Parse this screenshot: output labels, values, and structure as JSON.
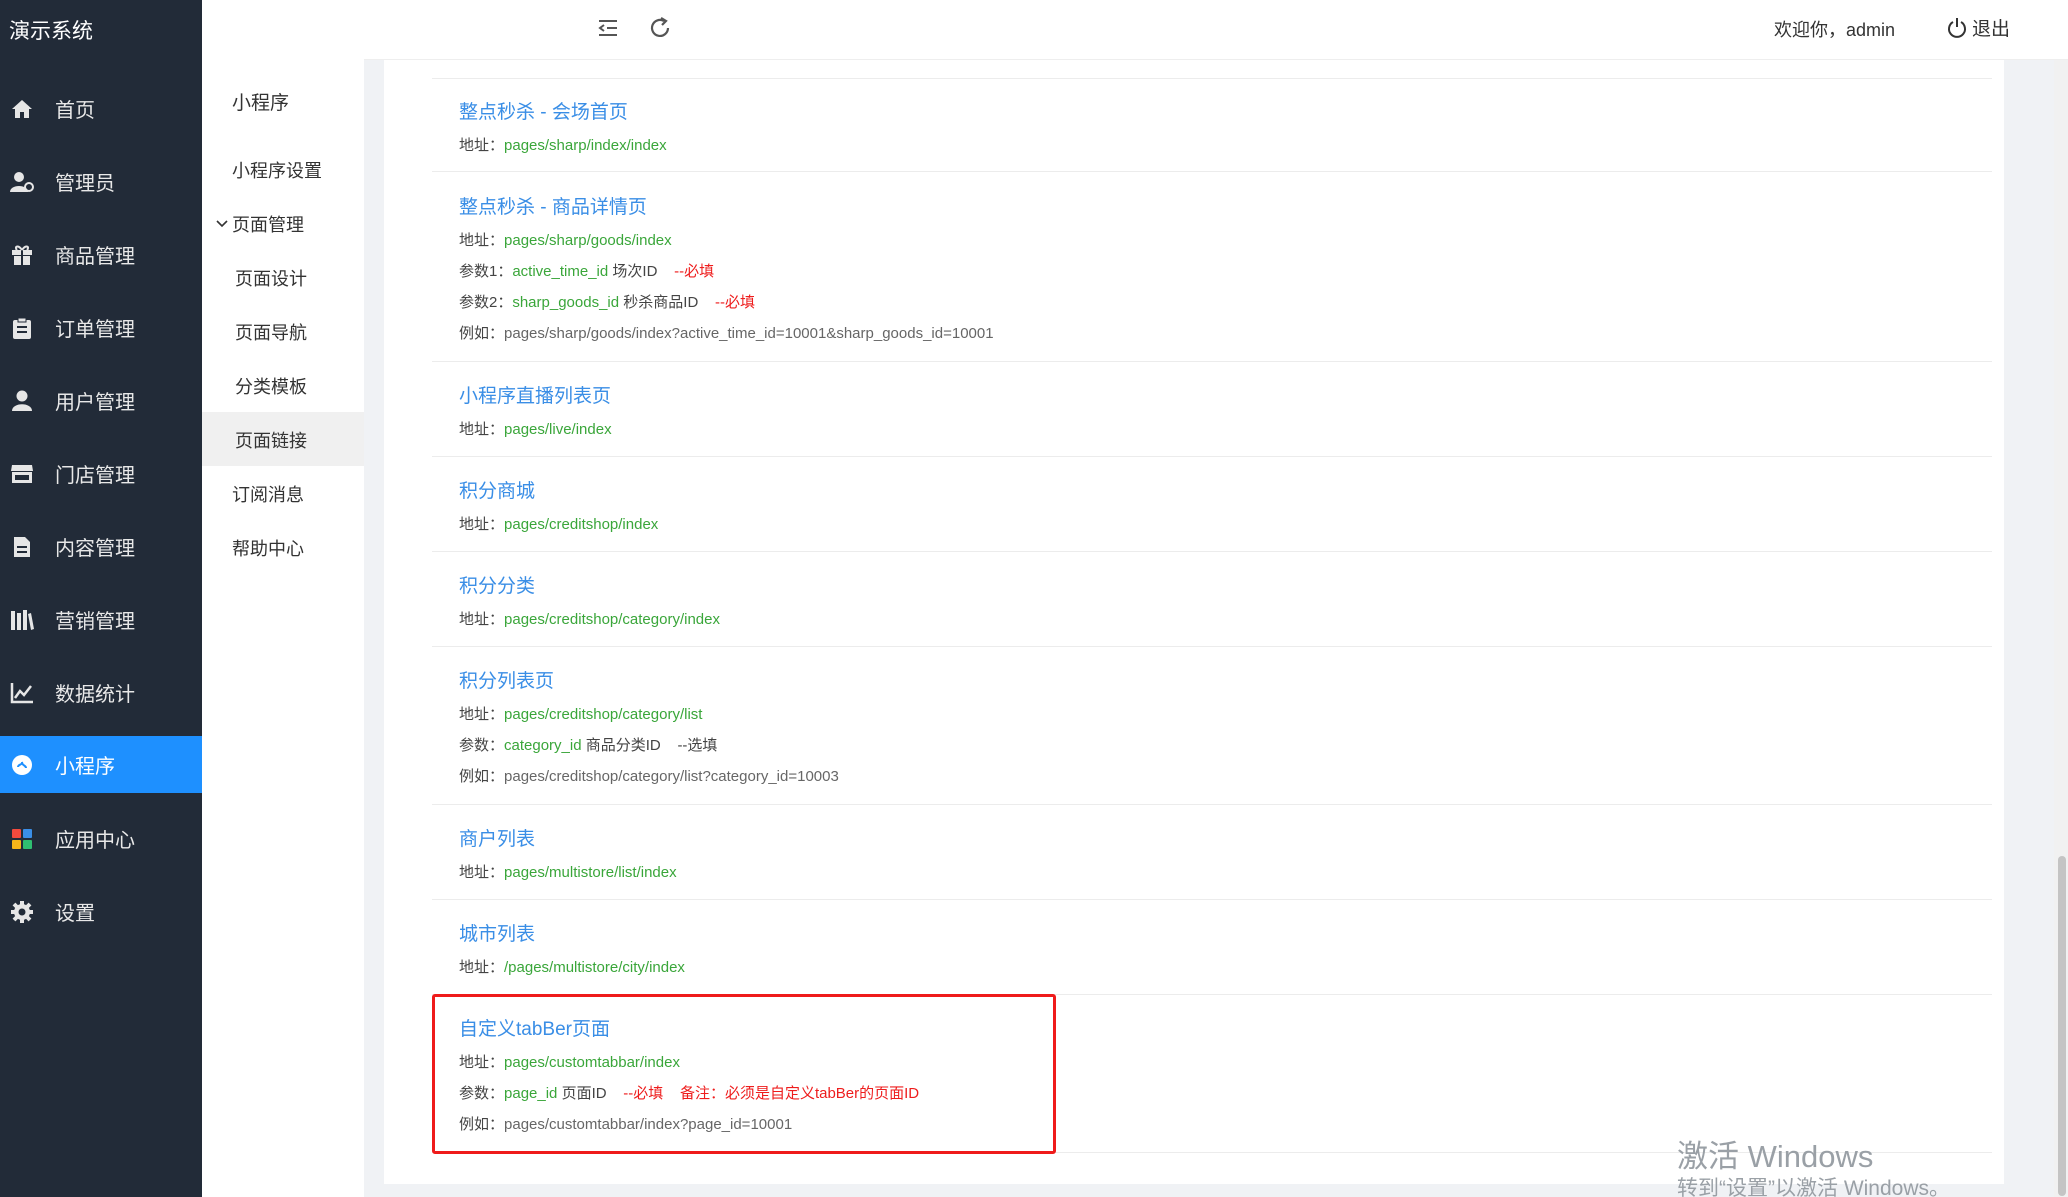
{
  "app": {
    "title": "演示系统"
  },
  "sidebar": {
    "items": [
      {
        "label": "首页",
        "icon": "home-icon"
      },
      {
        "label": "管理员",
        "icon": "admin-user-icon"
      },
      {
        "label": "商品管理",
        "icon": "gift-icon"
      },
      {
        "label": "订单管理",
        "icon": "clipboard-icon"
      },
      {
        "label": "用户管理",
        "icon": "user-icon"
      },
      {
        "label": "门店管理",
        "icon": "store-icon"
      },
      {
        "label": "内容管理",
        "icon": "document-icon"
      },
      {
        "label": "营销管理",
        "icon": "books-icon"
      },
      {
        "label": "数据统计",
        "icon": "line-chart-icon"
      },
      {
        "label": "小程序",
        "icon": "mini-program-icon",
        "active": true
      },
      {
        "label": "应用中心",
        "icon": "apps-grid-icon"
      },
      {
        "label": "设置",
        "icon": "gear-icon"
      }
    ]
  },
  "submenu": {
    "title": "小程序",
    "items": [
      {
        "label": "小程序设置"
      },
      {
        "label": "页面管理",
        "expanded": true
      },
      {
        "label": "页面设计"
      },
      {
        "label": "页面导航"
      },
      {
        "label": "分类模板"
      },
      {
        "label": "页面链接",
        "active": true
      },
      {
        "label": "订阅消息"
      },
      {
        "label": "帮助中心"
      }
    ]
  },
  "header": {
    "welcome": "欢迎你，admin",
    "logout": "退出",
    "icons": [
      "collapse-menu-icon",
      "refresh-icon"
    ]
  },
  "labels": {
    "address": "地址：",
    "param": "参数：",
    "param1": "参数1：",
    "param2": "参数2：",
    "example": "例如："
  },
  "entries": [
    {
      "title": "整点秒杀 - 会场首页",
      "address": "pages/sharp/index/index"
    },
    {
      "title": "整点秒杀 - 商品详情页",
      "address": "pages/sharp/goods/index",
      "params": [
        {
          "name": "active_time_id",
          "desc": "场次ID",
          "flag": "--必填"
        },
        {
          "name": "sharp_goods_id",
          "desc": "秒杀商品ID",
          "flag": "--必填"
        }
      ],
      "example": "pages/sharp/goods/index?active_time_id=10001&sharp_goods_id=10001"
    },
    {
      "title": "小程序直播列表页",
      "address": "pages/live/index"
    },
    {
      "title": "积分商城",
      "address": "pages/creditshop/index"
    },
    {
      "title": "积分分类",
      "address": "pages/creditshop/category/index"
    },
    {
      "title": "积分列表页",
      "address": "pages/creditshop/category/list",
      "params": [
        {
          "name": "category_id",
          "desc": "商品分类ID",
          "flag": "--选填"
        }
      ],
      "example": "pages/creditshop/category/list?category_id=10003"
    },
    {
      "title": "商户列表",
      "address": "pages/multistore/list/index"
    },
    {
      "title": "城市列表",
      "address": "/pages/multistore/city/index"
    },
    {
      "title": "自定义tabBer页面",
      "address": "pages/customtabbar/index",
      "params": [
        {
          "name": "page_id",
          "desc": "页面ID",
          "flag": "--必填",
          "note": "备注：必须是自定义tabBer的页面ID"
        }
      ],
      "example": "pages/customtabbar/index?page_id=10001",
      "highlighted": true
    }
  ],
  "watermark": {
    "line1": "激活 Windows",
    "line2": "转到“设置”以激活 Windows。"
  },
  "colors": {
    "sidebar_bg": "#222b38",
    "active_blue": "#1e90ff",
    "link_blue": "#3a8ee6",
    "path_green": "#3aa63a",
    "required_red": "#ee1d1d"
  }
}
